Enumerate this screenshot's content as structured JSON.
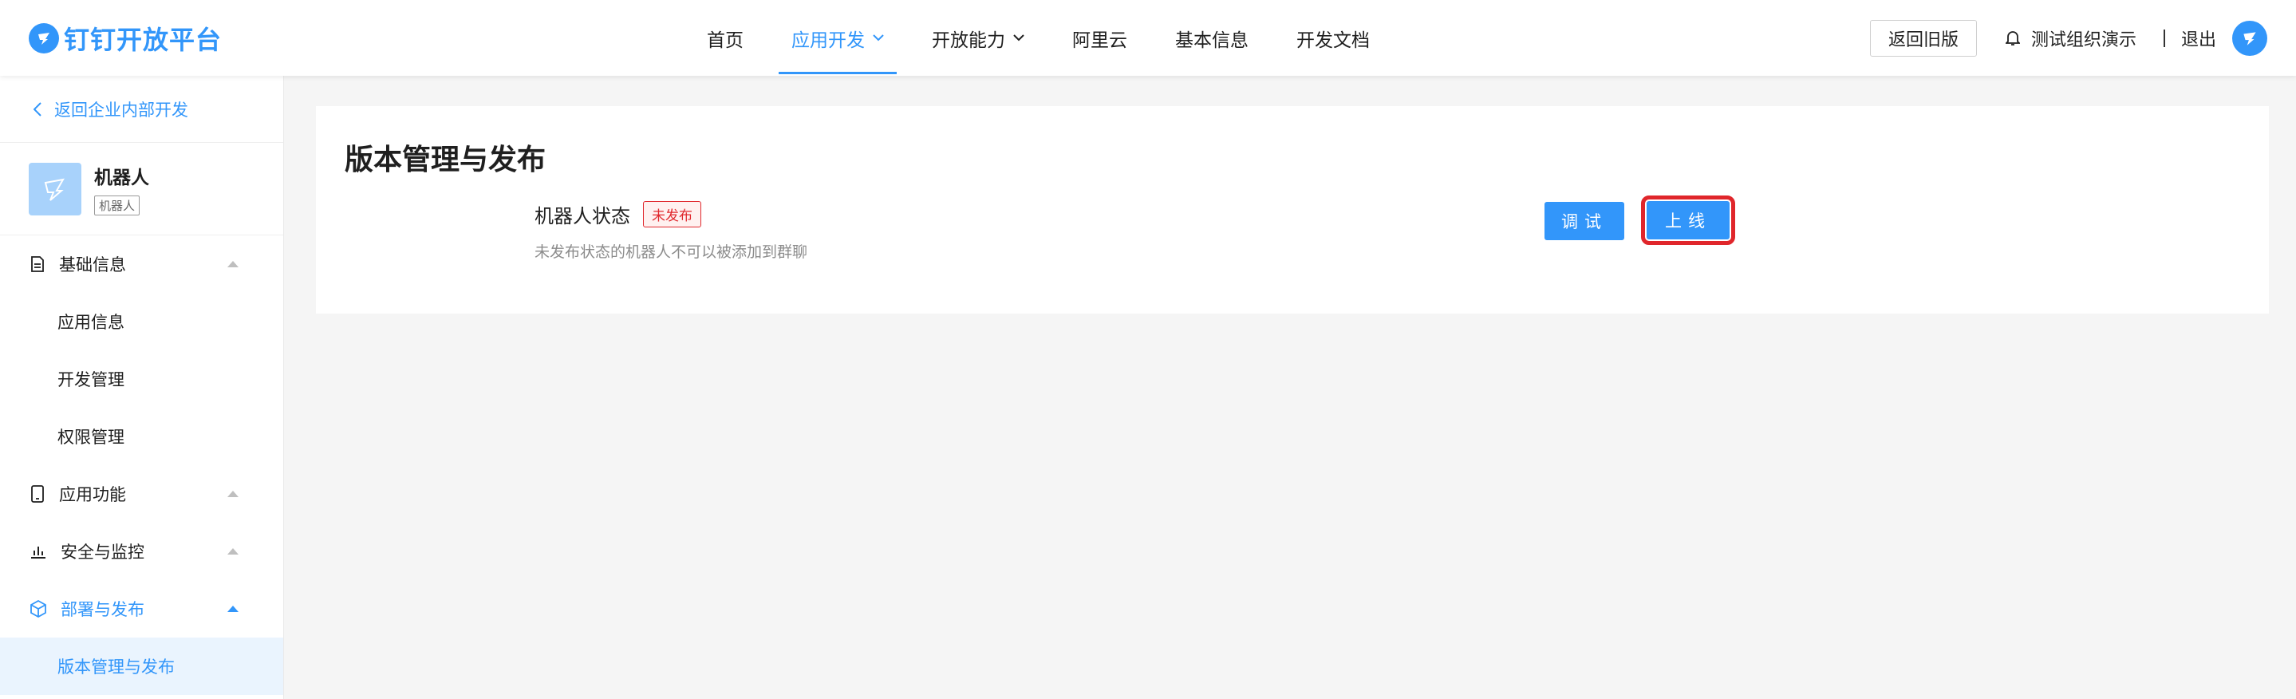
{
  "header": {
    "logo_text": "钉钉开放平台",
    "nav": [
      {
        "label": "首页",
        "active": false,
        "has_dropdown": false
      },
      {
        "label": "应用开发",
        "active": true,
        "has_dropdown": true
      },
      {
        "label": "开放能力",
        "active": false,
        "has_dropdown": true
      },
      {
        "label": "阿里云",
        "active": false,
        "has_dropdown": false
      },
      {
        "label": "基本信息",
        "active": false,
        "has_dropdown": false
      },
      {
        "label": "开发文档",
        "active": false,
        "has_dropdown": false
      }
    ],
    "old_version_label": "返回旧版",
    "org_name": "测试组织演示",
    "logout_label": "退出"
  },
  "sidebar": {
    "back_label": "返回企业内部开发",
    "app": {
      "name": "机器人",
      "tag": "机器人"
    },
    "groups": [
      {
        "label": "基础信息",
        "icon": "file-icon",
        "expanded": true,
        "active": false,
        "items": [
          {
            "label": "应用信息"
          },
          {
            "label": "开发管理"
          },
          {
            "label": "权限管理"
          }
        ]
      },
      {
        "label": "应用功能",
        "icon": "mobile-icon",
        "expanded": false,
        "active": false,
        "items": []
      },
      {
        "label": "安全与监控",
        "icon": "chart-icon",
        "expanded": false,
        "active": false,
        "items": []
      },
      {
        "label": "部署与发布",
        "icon": "cube-icon",
        "expanded": true,
        "active": true,
        "items": [
          {
            "label": "版本管理与发布",
            "active": true
          }
        ]
      }
    ]
  },
  "main": {
    "title": "版本管理与发布",
    "status_label": "机器人状态",
    "status_badge": "未发布",
    "status_desc": "未发布状态的机器人不可以被添加到群聊",
    "debug_label": "调试",
    "online_label": "上线"
  },
  "colors": {
    "accent": "#3296fa",
    "danger": "#e0292e",
    "highlight": "#e0262b"
  }
}
